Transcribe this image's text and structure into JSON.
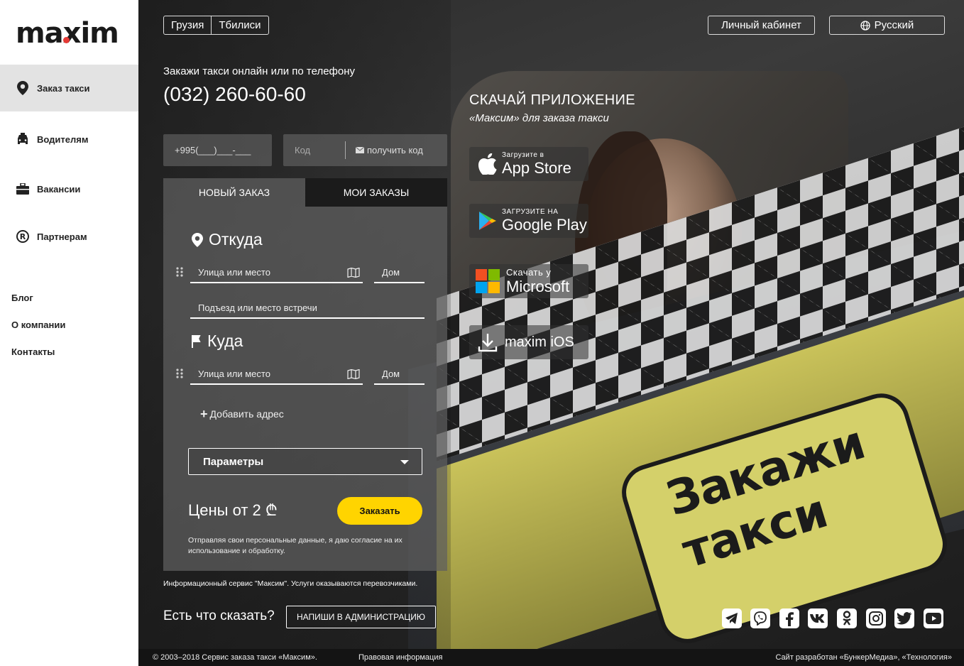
{
  "brand": {
    "logo": "maxim"
  },
  "sidebar": {
    "items": [
      {
        "label": "Заказ такси",
        "icon": "map-pin-icon",
        "active": true
      },
      {
        "label": "Водителям",
        "icon": "car-icon",
        "active": false
      },
      {
        "label": "Вакансии",
        "icon": "briefcase-icon",
        "active": false
      },
      {
        "label": "Партнерам",
        "icon": "registered-icon",
        "active": false
      }
    ],
    "links": [
      "Блог",
      "О компании",
      "Контакты"
    ]
  },
  "header": {
    "country": "Грузия",
    "city": "Тбилиси",
    "account_label": "Личный кабинет",
    "language_label": "Русский"
  },
  "hero": {
    "tagline": "Закажи такси онлайн или по телефону",
    "phone": "(032) 260-60-60"
  },
  "auth": {
    "phone_placeholder": "+995(___)___-___",
    "code_placeholder": "Код",
    "get_code_label": "получить код"
  },
  "order": {
    "tabs": [
      "НОВЫЙ ЗАКАЗ",
      "МОИ ЗАКАЗЫ"
    ],
    "from_label": "Откуда",
    "to_label": "Куда",
    "street_placeholder": "Улица или место",
    "house_placeholder": "Дом",
    "entrance_placeholder": "Подъезд или место встречи",
    "add_address_label": "Добавить адрес",
    "params_label": "Параметры",
    "price_label": "Цены от 2 ₾",
    "order_button": "Заказать",
    "consent": "Отправляя свои персональные данные, я даю согласие на их использование и обработку."
  },
  "info_text": "Информационный сервис \"Максим\". Услуги оказываются перевозчиками.",
  "feedback": {
    "label": "Есть что сказать?",
    "button": "НАПИШИ В АДМИНИСТРАЦИЮ"
  },
  "download": {
    "title": "СКАЧАЙ ПРИЛОЖЕНИЕ",
    "subtitle": "«Максим» для заказа такси",
    "stores": [
      {
        "small": "Загрузите в",
        "big": "App Store",
        "icon": "apple-icon"
      },
      {
        "small": "ЗАГРУЗИТЕ НА",
        "big": "Google Play",
        "icon": "google-play-icon"
      },
      {
        "small": "Скачать у",
        "big": "Microsoft",
        "icon": "microsoft-icon"
      },
      {
        "small": "",
        "big": "maxim iOS",
        "icon": "download-icon"
      }
    ]
  },
  "banner_text": "Закажи такси",
  "social": [
    "telegram-icon",
    "viber-icon",
    "facebook-icon",
    "vk-icon",
    "odnoklassniki-icon",
    "instagram-icon",
    "twitter-icon",
    "youtube-icon"
  ],
  "footer": {
    "copyright": "© 2003–2018 Сервис заказа такси «Максим».",
    "legal": "Правовая информация",
    "credits": "Сайт разработан «БункерМедиа», «Технология»"
  },
  "colors": {
    "accent": "#ffd400",
    "logo_dot": "#e53935",
    "sidebar_active": "#e3e3e3"
  }
}
